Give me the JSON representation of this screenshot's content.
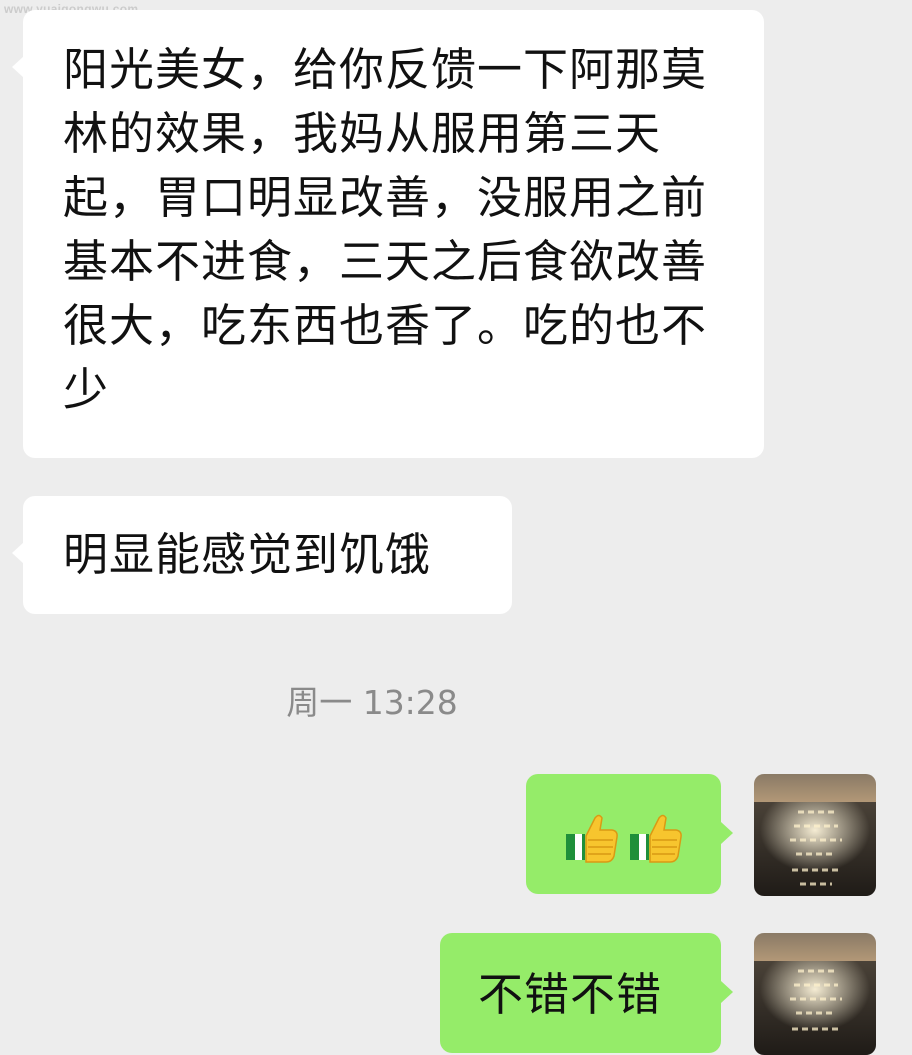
{
  "watermark": "www.yuaigongwu.com",
  "messages": [
    {
      "side": "in",
      "text": "阳光美女，给你反馈一下阿那莫林的效果，我妈从服用第三天起，胃口明显改善，没服用之前基本不进食，三天之后食欲改善很大，吃东西也香了。吃的也不少"
    },
    {
      "side": "in",
      "text": "明显能感觉到饥饿"
    },
    {
      "side": "out",
      "emoji": [
        "thumbs-up-icon",
        "thumbs-up-icon"
      ]
    },
    {
      "side": "out",
      "text": "不错不错"
    }
  ],
  "timestamp": "周一 13:28",
  "colors": {
    "background": "#ededed",
    "incoming_bubble": "#ffffff",
    "outgoing_bubble": "#95ec69",
    "timestamp_text": "#8a8a8a"
  }
}
